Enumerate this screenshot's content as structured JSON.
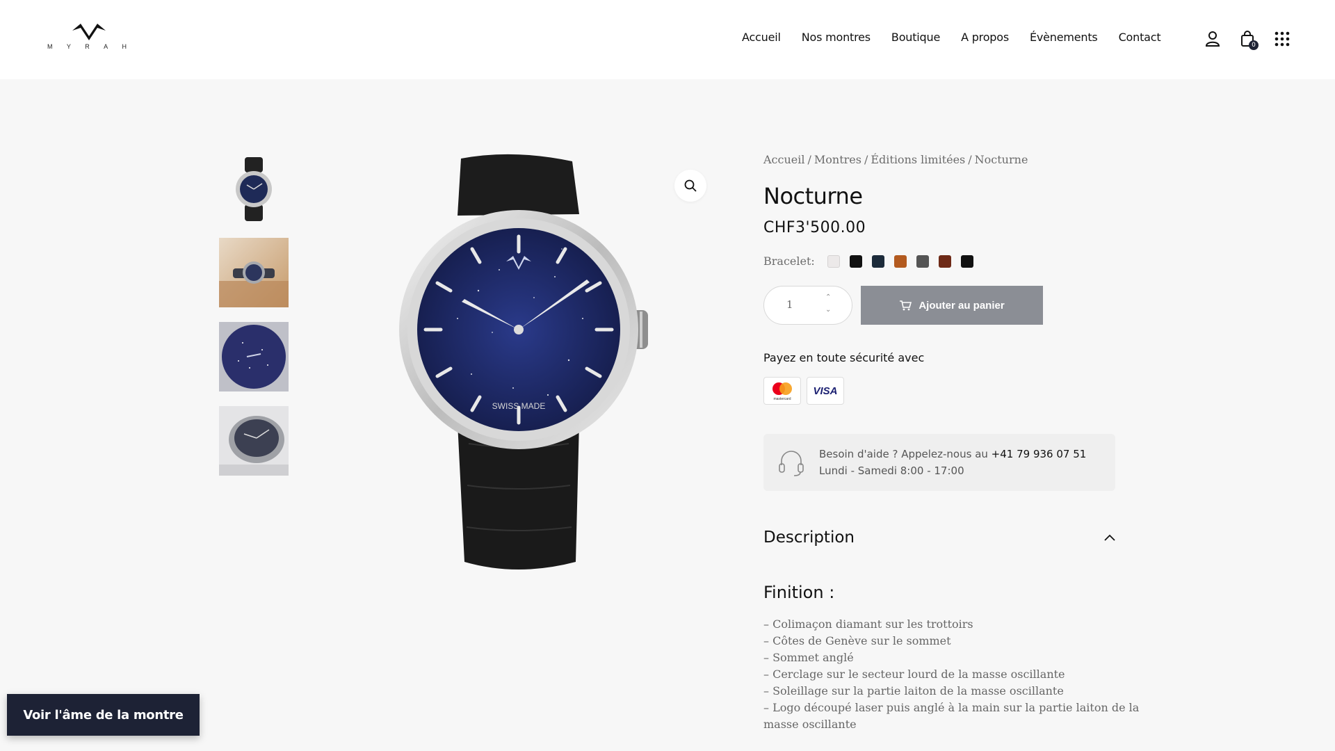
{
  "header": {
    "logo_text": [
      "M",
      "Y",
      "R",
      "A",
      "H"
    ],
    "nav": [
      "Accueil",
      "Nos montres",
      "Boutique",
      "A propos",
      "Évènements",
      "Contact"
    ],
    "cart_count": "0"
  },
  "gallery": {
    "thumbnails": [
      "watch-front",
      "watch-lifestyle",
      "dial-closeup",
      "watch-angle"
    ],
    "dial_text": "SWISS MADE"
  },
  "product": {
    "breadcrumb": [
      "Accueil",
      "Montres",
      "Éditions limitées",
      "Nocturne"
    ],
    "title": "Nocturne",
    "price": "CHF3'500.00",
    "swatch_label": "Bracelet:",
    "swatches": [
      "#ece9e9",
      "#111111",
      "#1c2b3a",
      "#b35a1f",
      "#555555",
      "#6e2a17",
      "#111111"
    ],
    "quantity": "1",
    "add_to_cart": "Ajouter au panier",
    "secure_text": "Payez en toute sécurité avec",
    "cards": [
      "mastercard",
      "VISA"
    ],
    "help_line1": "Besoin d'aide ? Appelez-nous au ",
    "help_phone": "+41 79 936 07 51",
    "help_line2": "Lundi - Samedi 8:00 - 17:00"
  },
  "description": {
    "title": "Description",
    "subtitle": "Finition :",
    "features": [
      "– Colimaçon diamant sur les trottoirs",
      "– Côtes de Genève sur le sommet",
      "– Sommet anglé",
      "– Cerclage sur le secteur lourd de la masse oscillante",
      "– Soleillage sur la partie laiton de la masse oscillante",
      "– Logo découpé laser puis anglé à la main sur la partie laiton de la",
      "masse oscillante"
    ]
  },
  "floating_button": "Voir l'âme de la montre"
}
